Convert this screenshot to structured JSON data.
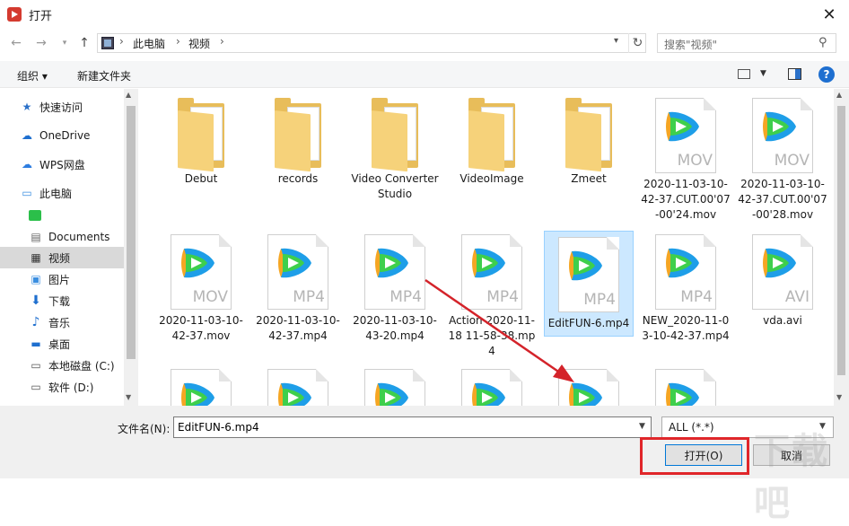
{
  "window": {
    "title": "打开",
    "close": "✕"
  },
  "address": {
    "crumbs": [
      "此电脑",
      "视频"
    ],
    "search_placeholder": "搜索\"视频\""
  },
  "toolbar": {
    "organize": "组织 ▾",
    "new_folder": "新建文件夹",
    "help": "?"
  },
  "sidebar": {
    "items": [
      {
        "label": "快速访问",
        "icon": "star-icon"
      },
      {
        "label": "OneDrive",
        "icon": "cloud-icon"
      },
      {
        "label": "WPS网盘",
        "icon": "cloud-icon"
      },
      {
        "label": "此电脑",
        "icon": "computer-icon"
      },
      {
        "label": "",
        "icon": "app-green-icon"
      },
      {
        "label": "Documents",
        "icon": "document-icon"
      },
      {
        "label": "视频",
        "icon": "film-icon"
      },
      {
        "label": "图片",
        "icon": "picture-icon"
      },
      {
        "label": "下载",
        "icon": "download-arrow-icon"
      },
      {
        "label": "音乐",
        "icon": "music-note-icon"
      },
      {
        "label": "桌面",
        "icon": "desktop-icon"
      },
      {
        "label": "本地磁盘 (C:)",
        "icon": "drive-icon"
      },
      {
        "label": "软件 (D:)",
        "icon": "drive-icon"
      }
    ]
  },
  "files": [
    {
      "name": "Debut",
      "kind": "folder"
    },
    {
      "name": "records",
      "kind": "folder"
    },
    {
      "name": "Video Converter Studio",
      "kind": "folder"
    },
    {
      "name": "VideoImage",
      "kind": "folder"
    },
    {
      "name": "Zmeet",
      "kind": "folder"
    },
    {
      "name": "2020-11-03-10-42-37.CUT.00'07-00'24.mov",
      "kind": "video",
      "ext": "MOV"
    },
    {
      "name": "2020-11-03-10-42-37.CUT.00'07-00'28.mov",
      "kind": "video",
      "ext": "MOV"
    },
    {
      "name": "2020-11-03-10-42-37.mov",
      "kind": "video",
      "ext": "MOV"
    },
    {
      "name": "2020-11-03-10-42-37.mp4",
      "kind": "video",
      "ext": "MP4"
    },
    {
      "name": "2020-11-03-10-43-20.mp4",
      "kind": "video",
      "ext": "MP4"
    },
    {
      "name": "Action 2020-11-18 11-58-38.mp4",
      "kind": "video",
      "ext": "MP4"
    },
    {
      "name": "EditFUN-6.mp4",
      "kind": "video",
      "ext": "MP4"
    },
    {
      "name": "NEW_2020-11-03-10-42-37.mp4",
      "kind": "video",
      "ext": "MP4"
    },
    {
      "name": "vda.avi",
      "kind": "video",
      "ext": "AVI"
    }
  ],
  "bottom": {
    "filename_label": "文件名(N):",
    "filename_value": "EditFUN-6.mp4",
    "filter": "ALL (*.*)",
    "open": "打开(O)",
    "cancel": "取消"
  },
  "colors": {
    "accent": "#0078d7",
    "highlight": "#e0262a",
    "selection": "#cce8ff"
  }
}
